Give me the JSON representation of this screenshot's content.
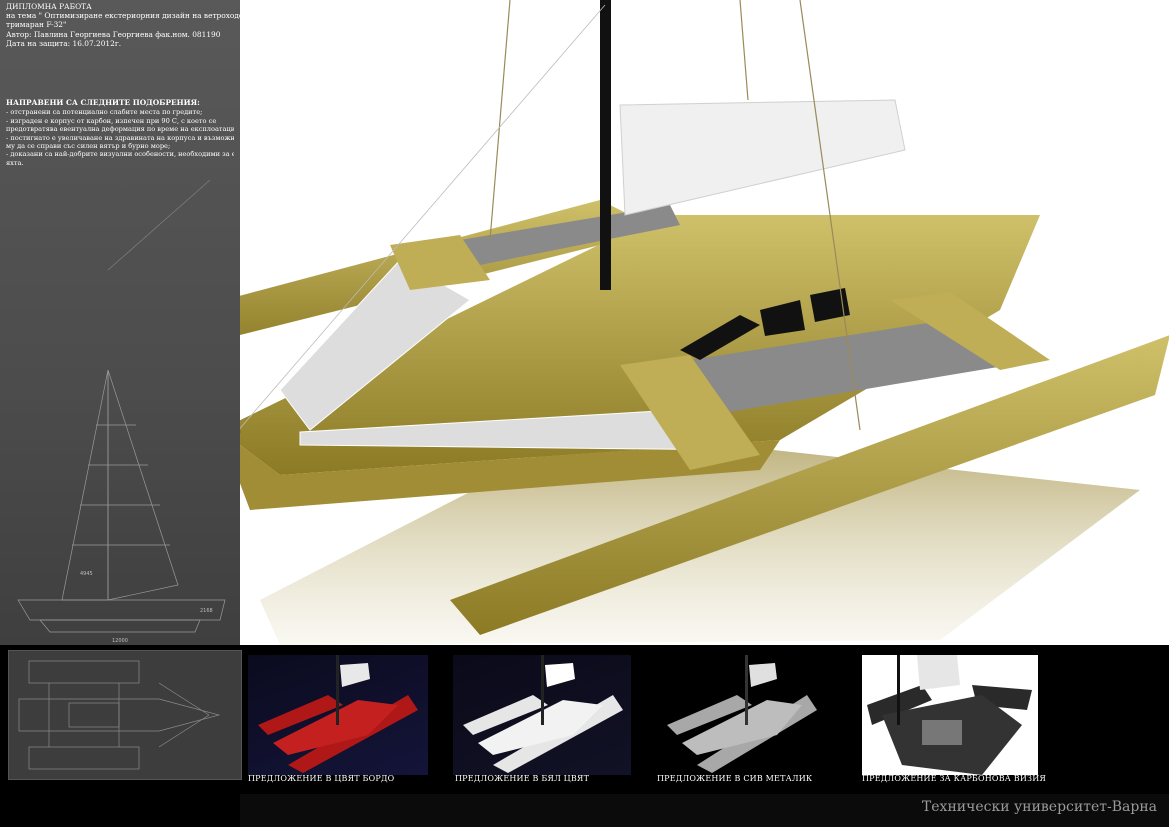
{
  "project_info": {
    "lines": [
      "ДИПЛОМНА РАБОТА",
      "на тема \" Оптимизиране екстериорния дизайн на ветроходен",
      "тримаран F-32\"",
      "Автор: Павлина Георгиева Георгиева фак.ном. 081190",
      "Дата на защита: 16.07.2012г."
    ]
  },
  "improvements": {
    "heading": "НАПРАВЕНИ СА СЛЕДНИТЕ ПОДОБРЕНИЯ:",
    "items": [
      "- отстранени са потенциално слабите места по гредите;",
      "- изграден е корпус от карбон, изпечен при 90 С, с което се",
      "предотвратява евентуална деформация по време на експлоатация;",
      "- постигнато е увеличаване на здравината на корпуса и възможността",
      "му да се справи със силен вятър и бурно море;",
      "- доказани са най-добрите визуални особености, необходими за една",
      "яхта."
    ]
  },
  "drawing_dimensions": [
    "4945",
    "2168",
    "12000"
  ],
  "variants": [
    {
      "caption": "ПРЕДЛОЖЕНИЕ В ЦВЯТ БОРДО"
    },
    {
      "caption": "ПРЕДЛОЖЕНИЕ В БЯЛ ЦВЯТ"
    },
    {
      "caption": "ПРЕДЛОЖЕНИЕ В СИВ МЕТАЛИК"
    },
    {
      "caption": "ПРЕДЛОЖЕНИЕ ЗА КАРБОНОВА ВИЗИЯ"
    }
  ],
  "footer": {
    "university": "Технически университет-Варна"
  },
  "colors": {
    "hull_gold": "#b5a140",
    "bordeaux": "#b01818",
    "panel_gray": "#555555",
    "background_black": "#000000"
  }
}
